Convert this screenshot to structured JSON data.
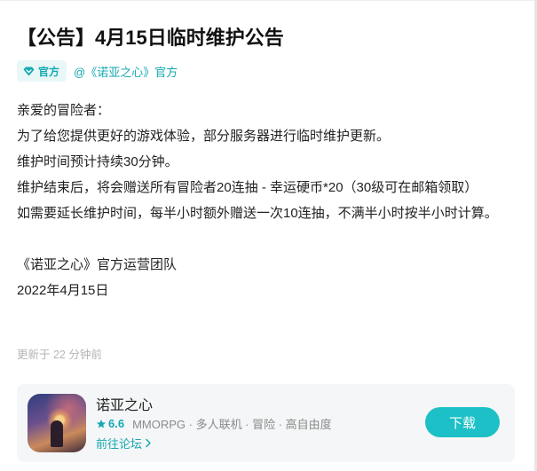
{
  "post": {
    "title": "【公告】4月15日临时维护公告",
    "badge_label": "官方",
    "author": "@《诺亚之心》官方",
    "paragraphs": [
      "亲爱的冒险者：",
      "为了给您提供更好的游戏体验，部分服务器进行临时维护更新。",
      "维护时间预计持续30分钟。",
      "维护结束后，将会赠送所有冒险者20连抽 - 幸运硬币*20（30级可在邮箱领取）",
      "如需要延长维护时间，每半小时额外赠送一次10连抽，不满半小时按半小时计算。",
      "",
      "《诺亚之心》官方运营团队",
      "2022年4月15日"
    ],
    "updated": "更新于 22 分钟前"
  },
  "app_card": {
    "name": "诺亚之心",
    "rating": "6.6",
    "tags": "MMORPG · 多人联机 · 冒险 · 高自由度",
    "forum_link": "前往论坛",
    "download_label": "下载"
  },
  "colors": {
    "accent": "#14a9b1",
    "button": "#1cc0c6",
    "card_bg": "#f5f6f7"
  },
  "icons": [
    "diamond-icon",
    "star-icon",
    "chevron-right-icon"
  ]
}
